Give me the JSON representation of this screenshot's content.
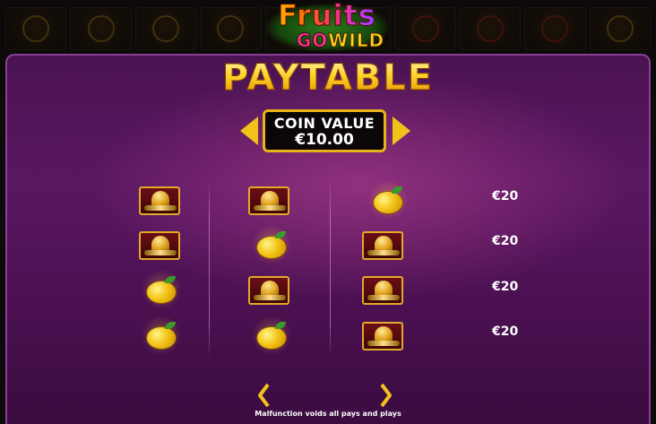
{
  "logo": {
    "line1": "Fruits",
    "line2_go": "GO",
    "line2_wild": "WILD"
  },
  "paytable": {
    "title": "PAYTABLE",
    "coin_label": "COIN VALUE",
    "coin_value": "€10.00",
    "rows": [
      {
        "symbols": [
          "bell-icon",
          "bell-icon",
          "lemon-icon"
        ],
        "pay": "€20"
      },
      {
        "symbols": [
          "bell-icon",
          "lemon-icon",
          "bell-icon"
        ],
        "pay": "€20"
      },
      {
        "symbols": [
          "lemon-icon",
          "bell-icon",
          "bell-icon"
        ],
        "pay": "€20"
      },
      {
        "symbols": [
          "lemon-icon",
          "lemon-icon",
          "bell-icon"
        ],
        "pay": "€20"
      }
    ]
  },
  "footer": "Malfunction voids all pays and plays",
  "colors": {
    "gold": "#f2c21a",
    "panel": "#4b1352",
    "border": "#8a3f93"
  }
}
